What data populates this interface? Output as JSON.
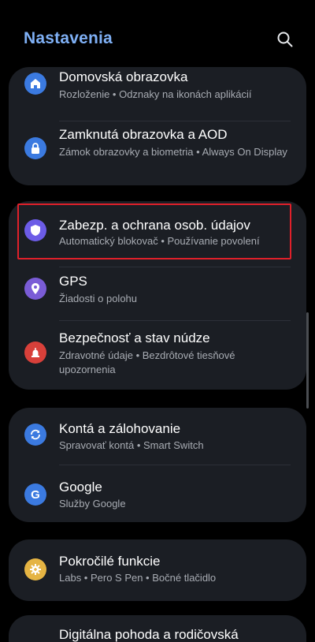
{
  "header": {
    "title": "Nastavenia"
  },
  "colors": {
    "accent": "#7fb0f5",
    "card": "#1b1e24",
    "highlight": "#e0202a",
    "home_icon": "#3b7ae0",
    "lock_icon": "#3b7ae0",
    "security_icon": "#6c5ce7",
    "gps_icon": "#7a5cd6",
    "emergency_icon": "#d8403a",
    "sync_icon": "#3b7ae0",
    "google_icon": "#3b7ae0",
    "advanced_icon": "#e5b443"
  },
  "groups": [
    {
      "items": [
        {
          "title": "Domovská obrazovka",
          "subtitle": "Rozloženie  •  Odznaky na ikonách aplikácií",
          "icon": "home-icon"
        },
        {
          "title": "Zamknutá obrazovka a AOD",
          "subtitle": "Zámok obrazovky a biometria  •  Always On Display",
          "icon": "lock-icon"
        }
      ]
    },
    {
      "items": [
        {
          "title": "Zabezp. a ochrana osob. údajov",
          "subtitle": "Automatický blokovač  •  Používanie povolení",
          "icon": "shield-icon"
        },
        {
          "title": "GPS",
          "subtitle": "Žiadosti o polohu",
          "icon": "location-pin-icon"
        },
        {
          "title": "Bezpečnosť a stav núdze",
          "subtitle": "Zdravotné údaje  •  Bezdrôtové tiesňové upozornenia",
          "icon": "emergency-light-icon"
        }
      ]
    },
    {
      "items": [
        {
          "title": "Kontá a zálohovanie",
          "subtitle": "Spravovať kontá  •  Smart Switch",
          "icon": "sync-icon"
        },
        {
          "title": "Google",
          "subtitle": "Služby Google",
          "icon": "google-icon",
          "glyph": "G"
        }
      ]
    },
    {
      "items": [
        {
          "title": "Pokročilé funkcie",
          "subtitle": "Labs  •  Pero S Pen  •  Bočné tlačidlo",
          "icon": "gear-plus-icon"
        }
      ]
    },
    {
      "items": [
        {
          "title": "Digitálna pohoda a rodičovská"
        }
      ]
    }
  ]
}
